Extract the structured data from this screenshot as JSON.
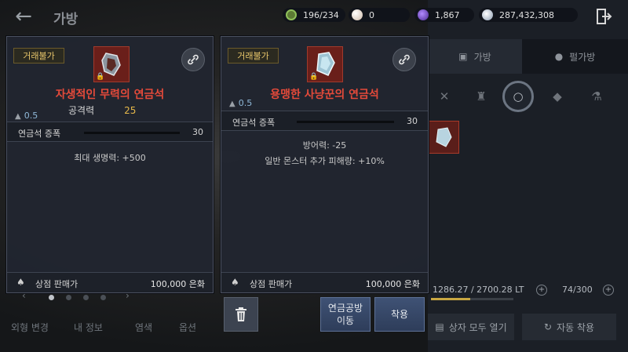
{
  "header": {
    "title": "가방",
    "resources": [
      {
        "icon": "energy-icon",
        "value": "196/234",
        "color": "#8fbf5a"
      },
      {
        "icon": "pearl-icon",
        "value": "0",
        "color": "#e8dcd0"
      },
      {
        "icon": "crystal-icon",
        "value": "1,867",
        "color": "#7a4fd0"
      },
      {
        "icon": "silver-icon",
        "value": "287,432,308",
        "color": "#b8c6d8"
      }
    ]
  },
  "right_panel": {
    "tabs": [
      "가방",
      "펄가방"
    ],
    "weight": "1286.27 / 2700.28 LT",
    "weight_fraction": 0.476,
    "slots": "74/300",
    "open_all_label": "상자 모두 열기",
    "auto_equip_label": "자동 착용"
  },
  "left_panel": {
    "tabs": [
      "외형 변경",
      "내 정보",
      "염색",
      "옵션"
    ],
    "page_count": 4,
    "active_page": 1
  },
  "card1": {
    "badge": "거래불가",
    "name": "자생적인 무력의 연금석",
    "stat_label": "공격력",
    "stat_value": "25",
    "weight": "0.5",
    "enh_label": "연금석 증폭",
    "enh_value": "30",
    "effects": [
      "최대 생명력: +500"
    ],
    "sell_label": "상점 판매가",
    "sell_price": "100,000 은화"
  },
  "card2": {
    "badge": "거래불가",
    "name": "용맹한 사냥꾼의 연금석",
    "weight": "0.5",
    "enh_label": "연금석 증폭",
    "enh_value": "30",
    "effects": [
      "방어력: -25",
      "일반 몬스터 추가 피해량: +10%"
    ],
    "sell_label": "상점 판매가",
    "sell_price": "100,000 은화"
  },
  "actions": {
    "workshop_line1": "연금공방",
    "workshop_line2": "이동",
    "equip_label": "착용"
  },
  "colors": {
    "item_name": "#e54a3a",
    "stat_value": "#e6b84a",
    "badge_text": "#e6c46a",
    "button": "#3f5275"
  }
}
